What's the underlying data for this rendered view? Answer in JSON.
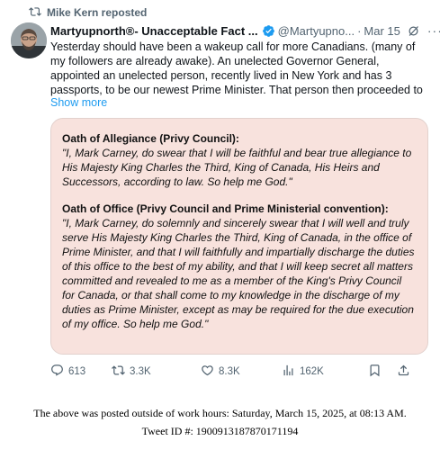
{
  "repost": {
    "label": "Mike Kern reposted",
    "icon": "repost-icon"
  },
  "post": {
    "display_name": "Martyupnorth®- Unacceptable Fact ...",
    "handle": "@Martyupno...",
    "separator": "·",
    "date": "Mar 15",
    "more": "···",
    "text": "Yesterday should have been a wakeup call for more Canadians. (many of my followers are already awake). An unelected Governor General, appointed an unelected person, recently lived in New York and has 3 passports, to be our newest Prime Minister. That person then proceeded to",
    "show_more": "Show more",
    "icons": {
      "verified": "verified-badge-icon",
      "grok": "grok-icon",
      "more": "more-options-icon"
    }
  },
  "quote_image": {
    "heading1": "Oath of Allegiance (Privy Council):",
    "quote1": "\"I, Mark Carney, do swear that I will be faithful and bear true allegiance to His Majesty King Charles the Third, King of Canada, His Heirs and Successors, according to law. So help me God.\"",
    "heading2": "Oath of Office (Privy Council and Prime Ministerial convention):",
    "quote2": "\"I, Mark Carney, do solemnly and sincerely swear that I will well and truly serve His Majesty King Charles the Third, King of Canada, in the office of Prime Minister, and that I will faithfully and impartially discharge the duties of this office to the best of my ability, and that I will keep secret all matters committed and revealed to me as a member of the King's Privy Council for Canada, or that shall come to my knowledge in the discharge of my duties as Prime Minister, except as may be required for the due execution of my office. So help me God.\""
  },
  "actions": {
    "replies": "613",
    "reposts": "3.3K",
    "likes": "8.3K",
    "views": "162K"
  },
  "footer": {
    "posted_note": "The above was posted outside of work hours: Saturday, March 15, 2025, at 08:13 AM.",
    "tweet_id": "Tweet ID #: 1900913187870171194"
  },
  "colors": {
    "accent": "#1d9bf0",
    "muted": "#536471",
    "quote_background": "#f8e2dd"
  }
}
